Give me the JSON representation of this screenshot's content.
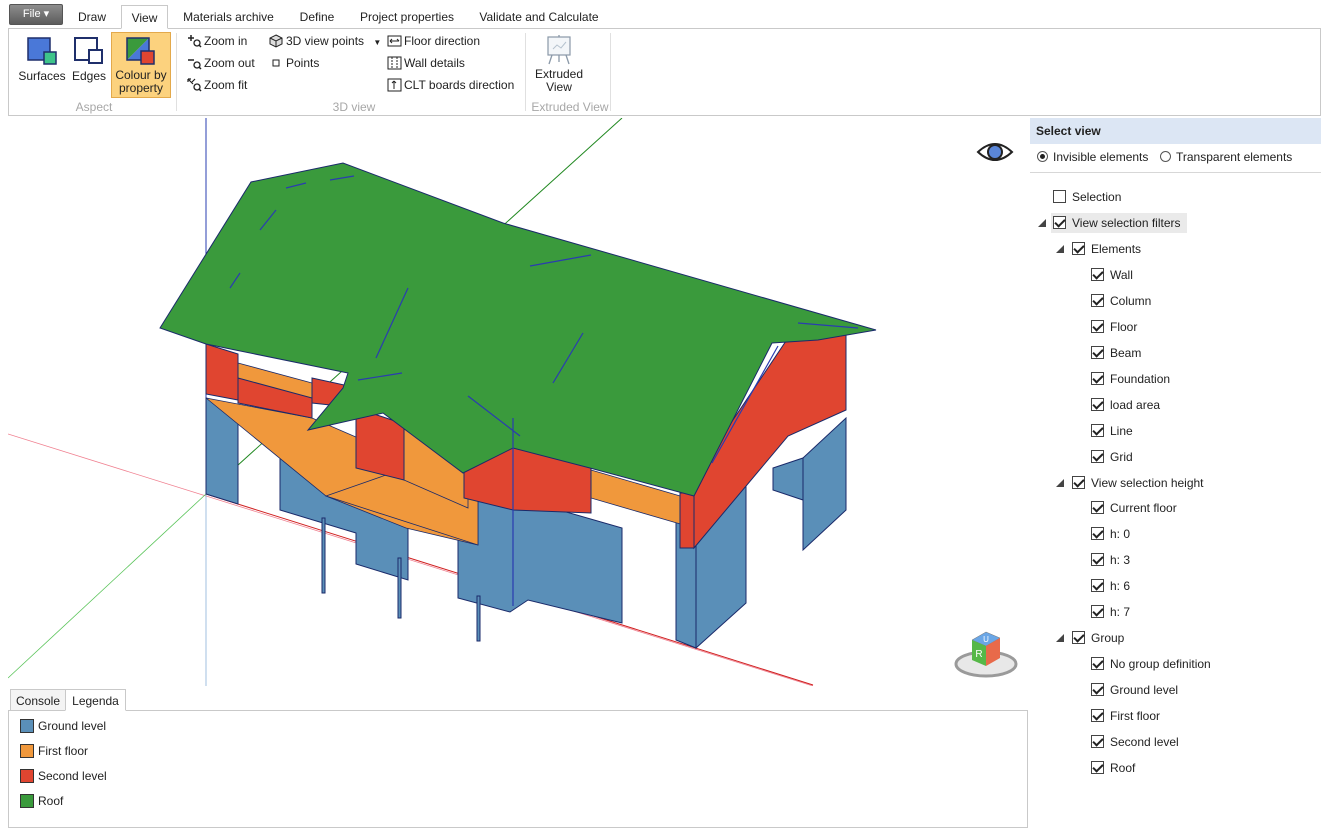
{
  "ribbon_tabs": {
    "file": "File ▾",
    "draw": "Draw",
    "view": "View",
    "materials": "Materials archive",
    "define": "Define",
    "project": "Project properties",
    "validate": "Validate and Calculate"
  },
  "ribbon": {
    "aspect": {
      "surfaces": "Surfaces",
      "edges": "Edges",
      "colour_line1": "Colour by",
      "colour_line2": "property",
      "group_label": "Aspect"
    },
    "view3d": {
      "zoom_in": "Zoom in",
      "zoom_out": "Zoom out",
      "zoom_fit": "Zoom fit",
      "view_points": "3D view points",
      "points": "Points",
      "floor_direction": "Floor direction",
      "wall_details": "Wall details",
      "clt_direction": "CLT boards direction",
      "group_label": "3D view"
    },
    "extruded": {
      "line1": "Extruded",
      "line2": "View",
      "group_label": "Extruded View"
    }
  },
  "bottom_tabs": {
    "console": "Console",
    "legenda": "Legenda"
  },
  "legend": [
    {
      "label": "Ground level",
      "color": "#5a8fb8"
    },
    {
      "label": "First floor",
      "color": "#f0983c"
    },
    {
      "label": "Second level",
      "color": "#e04530"
    },
    {
      "label": "Roof",
      "color": "#3a9a3c"
    }
  ],
  "panel": {
    "title": "Select view",
    "radio_invisible": "Invisible elements",
    "radio_transparent": "Transparent elements",
    "selection": "Selection",
    "view_filters": "View selection filters",
    "elements": "Elements",
    "element_items": [
      "Wall",
      "Column",
      "Floor",
      "Beam",
      "Foundation",
      "load area",
      "Line",
      "Grid"
    ],
    "height": "View selection height",
    "height_items": [
      "Current floor",
      "h: 0",
      "h: 3",
      "h: 6",
      "h: 7"
    ],
    "group": "Group",
    "group_items": [
      "No group definition",
      "Ground level",
      "First floor",
      "Second level",
      "Roof"
    ]
  },
  "viewcube": {
    "top": "U",
    "front": "R"
  }
}
